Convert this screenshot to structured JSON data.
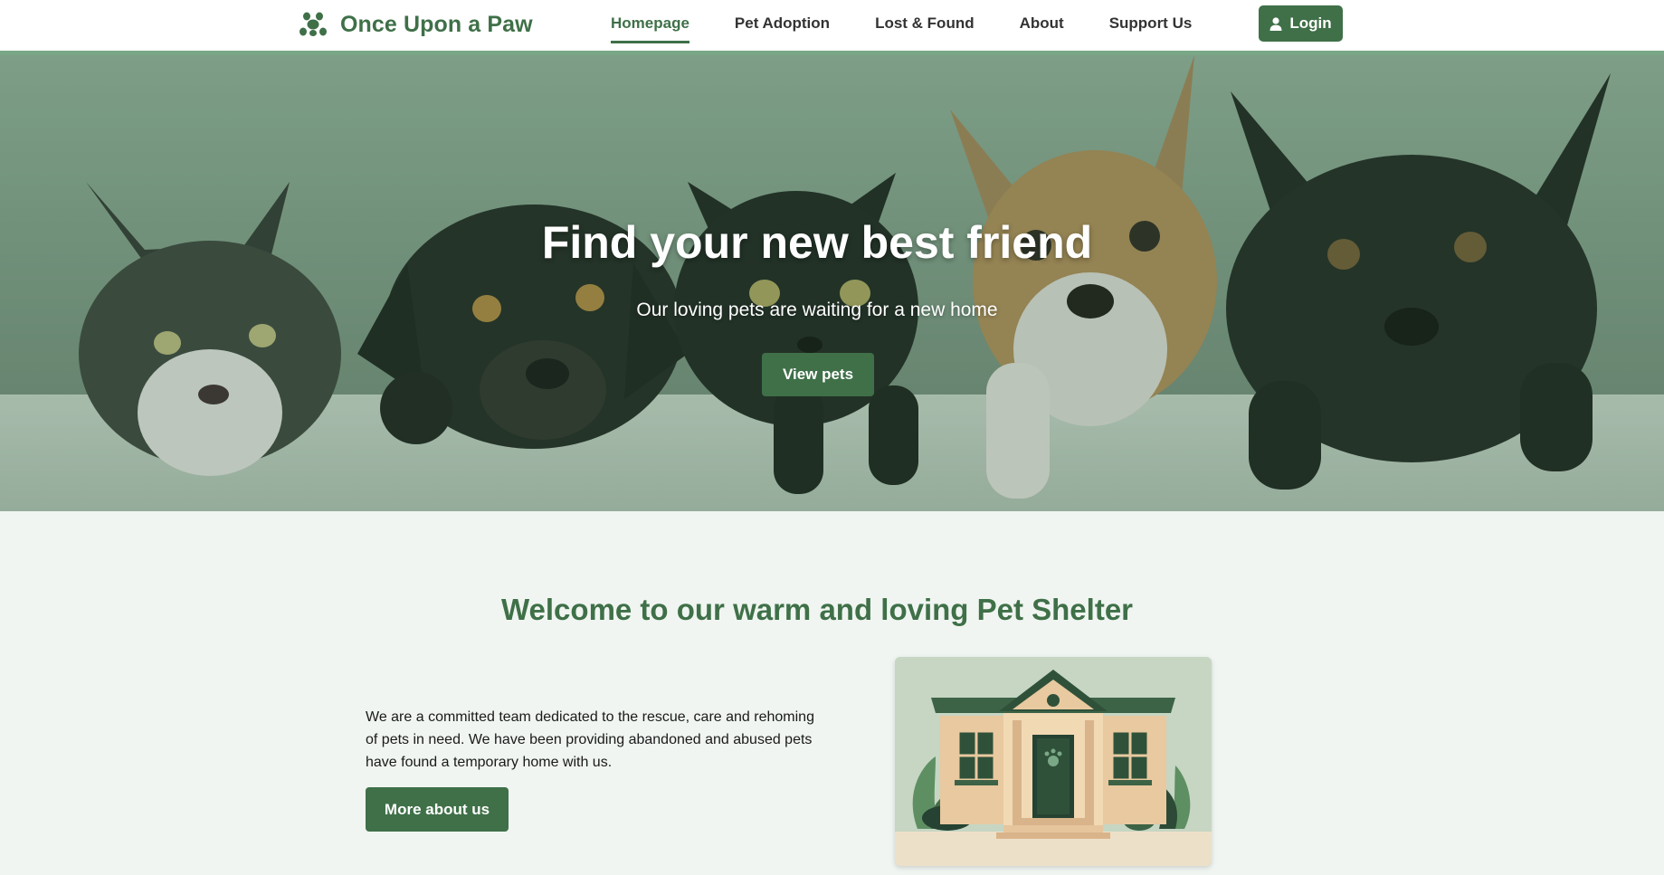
{
  "brand": {
    "name": "Once Upon a Paw",
    "icon": "paw-icon"
  },
  "nav": {
    "items": [
      {
        "label": "Homepage",
        "active": true
      },
      {
        "label": "Pet Adoption",
        "active": false
      },
      {
        "label": "Lost & Found",
        "active": false
      },
      {
        "label": "About",
        "active": false
      },
      {
        "label": "Support Us",
        "active": false
      }
    ],
    "login_label": "Login",
    "login_icon": "user-icon"
  },
  "hero": {
    "title": "Find your new best friend",
    "subtitle": "Our loving pets are waiting for a new home",
    "cta_label": "View pets",
    "image": "kittens-and-puppies-photo"
  },
  "welcome": {
    "title": "Welcome to our warm and loving Pet Shelter",
    "text": "We are a committed team dedicated to the rescue, care and rehoming of pets in need. We have been providing abandoned and abused pets have found a temporary home with us.",
    "cta_label": "More about us",
    "image": "shelter-house-illustration"
  },
  "colors": {
    "primary": "#3f7048",
    "accent_border": "#7aa886",
    "section_bg": "#f0f5f1"
  }
}
